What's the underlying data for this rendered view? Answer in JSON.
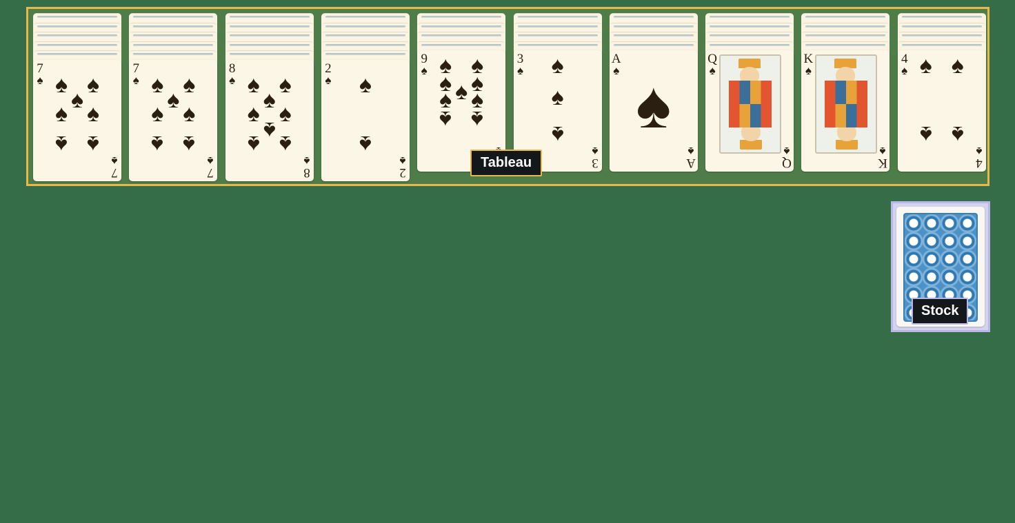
{
  "colors": {
    "felt": "#346d48",
    "tableau_border": "#e9b84a",
    "stock_border": "#b8b7e6",
    "card_face": "#fcf6e6",
    "ink": "#2a1f10"
  },
  "tableau": {
    "label": "Tableau",
    "columns": [
      {
        "facedown_count": 5,
        "card": {
          "rank": "7",
          "suit": "♠",
          "suit_name": "spades"
        }
      },
      {
        "facedown_count": 5,
        "card": {
          "rank": "7",
          "suit": "♠",
          "suit_name": "spades"
        }
      },
      {
        "facedown_count": 5,
        "card": {
          "rank": "8",
          "suit": "♠",
          "suit_name": "spades"
        }
      },
      {
        "facedown_count": 5,
        "card": {
          "rank": "2",
          "suit": "♠",
          "suit_name": "spades"
        }
      },
      {
        "facedown_count": 4,
        "card": {
          "rank": "9",
          "suit": "♠",
          "suit_name": "spades"
        }
      },
      {
        "facedown_count": 4,
        "card": {
          "rank": "3",
          "suit": "♠",
          "suit_name": "spades"
        }
      },
      {
        "facedown_count": 4,
        "card": {
          "rank": "A",
          "suit": "♠",
          "suit_name": "spades"
        }
      },
      {
        "facedown_count": 4,
        "card": {
          "rank": "Q",
          "suit": "♠",
          "suit_name": "spades"
        }
      },
      {
        "facedown_count": 4,
        "card": {
          "rank": "K",
          "suit": "♠",
          "suit_name": "spades"
        }
      },
      {
        "facedown_count": 4,
        "card": {
          "rank": "4",
          "suit": "♠",
          "suit_name": "spades"
        }
      }
    ]
  },
  "stock": {
    "label": "Stock",
    "back_icon": "card-back-pattern"
  }
}
